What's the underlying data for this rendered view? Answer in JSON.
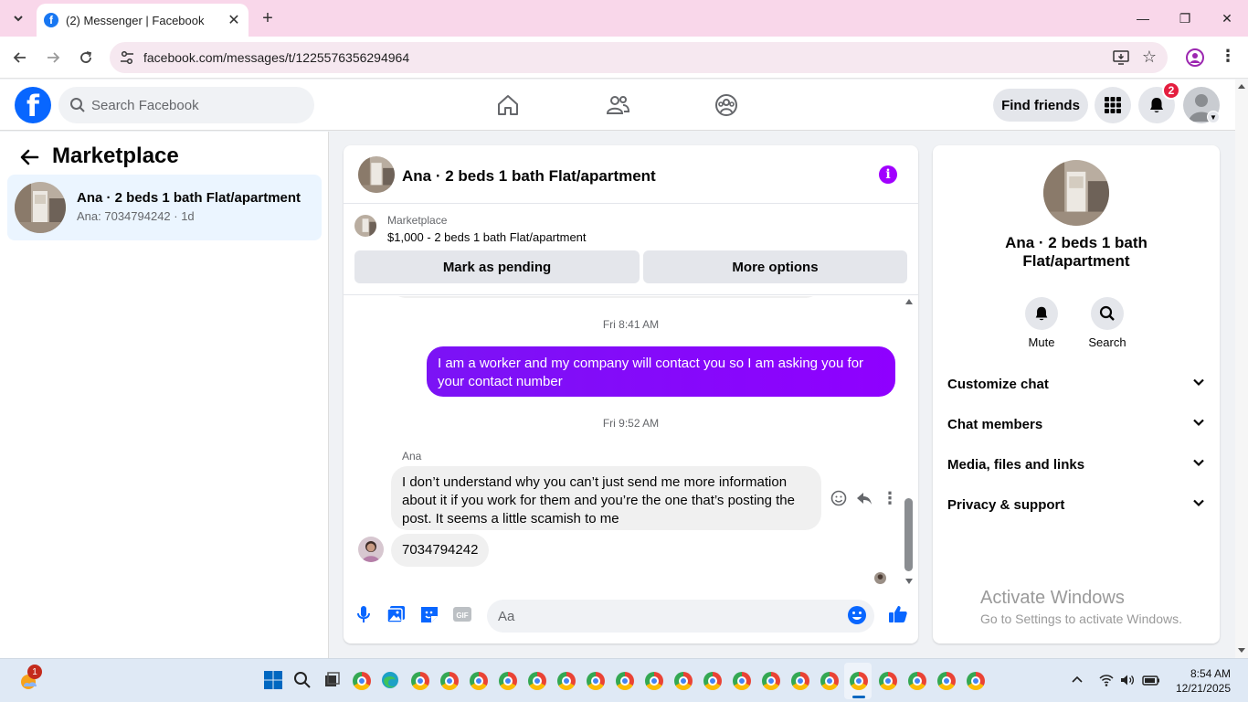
{
  "browser": {
    "tab_title": "(2) Messenger | Facebook",
    "url": "facebook.com/messages/t/1225576356294964"
  },
  "header": {
    "search_placeholder": "Search Facebook",
    "find_friends": "Find friends",
    "notification_count": "2"
  },
  "sidebar": {
    "title": "Marketplace",
    "conversations": [
      {
        "name": "Ana · 2 beds 1 bath Flat/apartment",
        "preview": "Ana: 7034794242 · 1d"
      }
    ]
  },
  "chat": {
    "title": "Ana · 2 beds 1 bath Flat/apartment",
    "marketplace_label": "Marketplace",
    "listing": "$1,000 - 2 beds 1 bath Flat/apartment",
    "mark_pending": "Mark as pending",
    "more_options": "More options",
    "messages": [
      {
        "type": "timestamp",
        "text": "Fri 8:41 AM"
      },
      {
        "type": "outgoing",
        "text": "I am a worker and my company will contact you so I am asking you for your contact number"
      },
      {
        "type": "timestamp",
        "text": "Fri 9:52 AM"
      },
      {
        "type": "sender",
        "text": "Ana"
      },
      {
        "type": "incoming",
        "text": "I don’t understand why you can’t just send me more information about it if you work for them and you’re the one that’s posting the post. It seems a little scamish to me"
      },
      {
        "type": "incoming",
        "text": "7034794242"
      }
    ],
    "composer_placeholder": "Aa"
  },
  "details": {
    "name": "Ana · 2 beds 1 bath Flat/apartment",
    "mute": "Mute",
    "search": "Search",
    "sections": [
      "Customize chat",
      "Chat members",
      "Media, files and links",
      "Privacy & support"
    ]
  },
  "watermark": {
    "line1": "Activate Windows",
    "line2": "Go to Settings to activate Windows."
  },
  "taskbar": {
    "weather_badge": "1",
    "time": "8:54 AM",
    "date": "12/21/2025"
  },
  "colors": {
    "fb_blue": "#0866ff",
    "outgoing_bubble": "#8a0cff",
    "accent_purple": "#a100ff"
  }
}
